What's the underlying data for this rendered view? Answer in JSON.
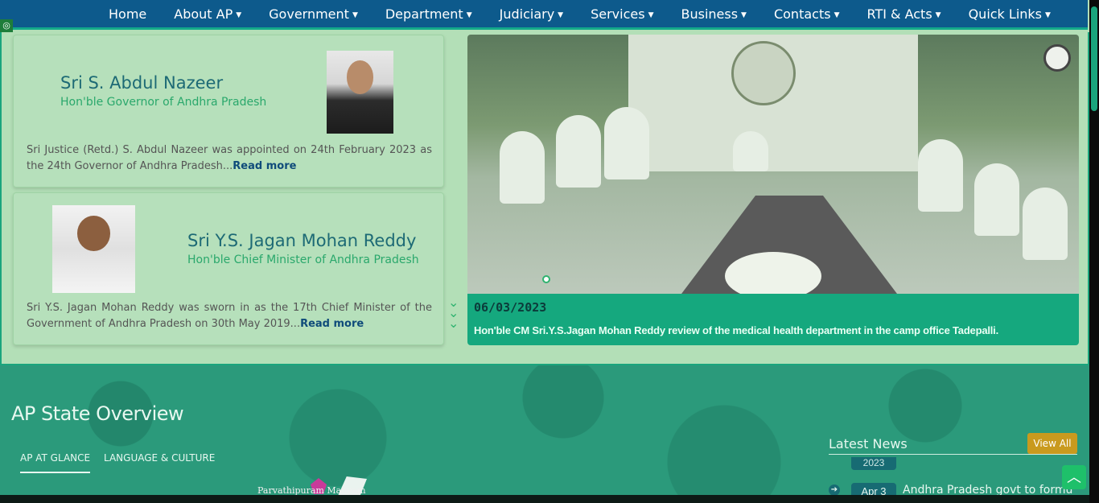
{
  "nav": {
    "items": [
      {
        "label": "Home",
        "has_dropdown": false
      },
      {
        "label": "About AP",
        "has_dropdown": true
      },
      {
        "label": "Government",
        "has_dropdown": true
      },
      {
        "label": "Department",
        "has_dropdown": true
      },
      {
        "label": "Judiciary",
        "has_dropdown": true
      },
      {
        "label": "Services",
        "has_dropdown": true
      },
      {
        "label": "Business",
        "has_dropdown": true
      },
      {
        "label": "Contacts",
        "has_dropdown": true
      },
      {
        "label": "RTI & Acts",
        "has_dropdown": true
      },
      {
        "label": "Quick Links",
        "has_dropdown": true
      }
    ]
  },
  "governor": {
    "name": "Sri S. Abdul Nazeer",
    "role": "Hon'ble Governor of Andhra Pradesh",
    "description": "Sri Justice (Retd.) S. Abdul Nazeer was appointed on 24th February 2023 as the 24th Governor of Andhra Pradesh...",
    "read_more": "Read more"
  },
  "chief_minister": {
    "name": "Sri Y.S. Jagan Mohan Reddy",
    "role": "Hon'ble Chief Minister of Andhra Pradesh",
    "description": "Sri Y.S. Jagan Mohan Reddy was sworn in as the 17th Chief Minister of the Government of Andhra Pradesh on 30th May 2019...",
    "read_more": "Read more"
  },
  "banner": {
    "date": "06/03/2023",
    "caption": "Hon'ble CM Sri.Y.S.Jagan Mohan Reddy review of the medical health department in the camp office Tadepalli."
  },
  "overview": {
    "title": "AP State Overview",
    "tabs": [
      {
        "label": "AP AT GLANCE",
        "active": true
      },
      {
        "label": "LANGUAGE & CULTURE",
        "active": false
      }
    ],
    "map_label": "Parvathipuram Manyam"
  },
  "news": {
    "title": "Latest News",
    "view_all": "View All",
    "year": "2023",
    "items": [
      {
        "date": "Apr 3",
        "text": "Andhra Pradesh govt to formulat"
      }
    ]
  },
  "icons": {
    "nav_caret": "caret-down-icon",
    "chevrons": "double-chevron-down-icon",
    "scroll_top": "chevron-up-icon",
    "news_arrow": "arrow-right-circle-icon",
    "corner": "accessibility-icon"
  },
  "colors": {
    "nav_bg": "#0d5a8c",
    "accent": "#15a87e",
    "page_bg": "#b3dfb7",
    "overview_bg": "#2b9a7b",
    "view_all_bg": "#c99a1e"
  }
}
